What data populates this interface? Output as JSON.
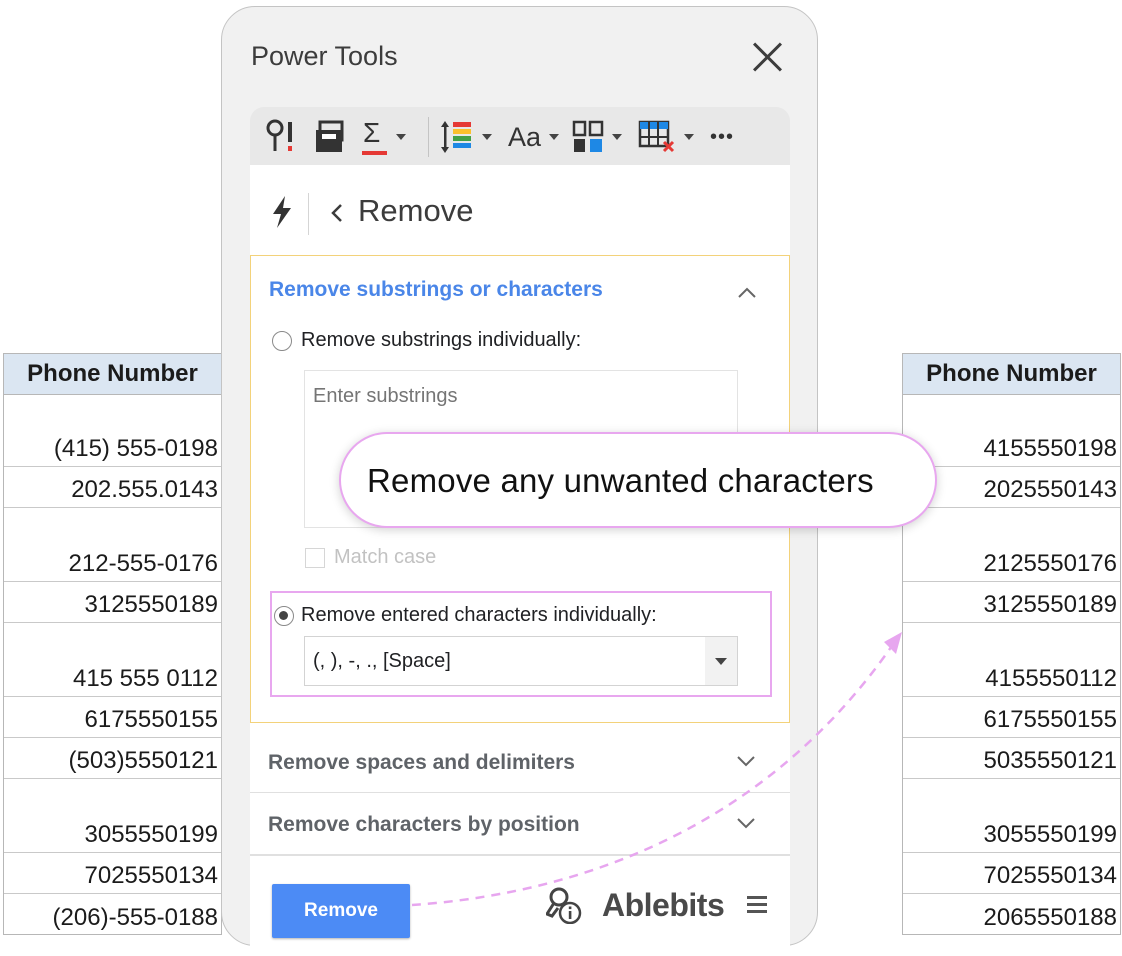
{
  "left_sheet": {
    "header": "Phone Number",
    "cells": [
      "(415) 555-0198",
      "202.555.0143",
      "212-555-0176",
      "3125550189",
      "415 555 0112",
      "6175550155",
      "(503)5550121",
      "3055550199",
      "7025550134",
      "(206)-555-0188"
    ]
  },
  "right_sheet": {
    "header": "Phone Number",
    "cells": [
      "4155550198",
      "2025550143",
      "2125550176",
      "3125550189",
      "4155550112",
      "6175550155",
      "5035550121",
      "3055550199",
      "7025550134",
      "2065550188"
    ]
  },
  "panel": {
    "title": "Power Tools",
    "toolbar": {
      "icons": [
        "key-info-icon",
        "save-icon",
        "sigma-icon",
        "sort-icon",
        "text-case-icon",
        "split-icon",
        "table-delete-icon",
        "more-icon"
      ],
      "text_case_label": "Aa",
      "sigma_label": "Σ",
      "more_label": "•••"
    },
    "nav": {
      "title": "Remove",
      "back_label": "‹"
    },
    "section_open": {
      "title": "Remove substrings or characters",
      "radio1_label": "Remove substrings individually:",
      "substrings_placeholder": "Enter substrings",
      "match_case_label": "Match case",
      "radio2_label": "Remove entered characters individually:",
      "characters_value": "(, ), -, ., [Space]"
    },
    "section_spaces": {
      "title": "Remove spaces and delimiters"
    },
    "section_position": {
      "title": "Remove characters by position"
    },
    "footer": {
      "remove_label": "Remove",
      "brand": "Ablebits"
    }
  },
  "callout": {
    "text": "Remove any unwanted characters"
  },
  "colors": {
    "accent_blue": "#4a86e8",
    "button_blue": "#4c8bf5",
    "highlight_pink": "#e8a7ef",
    "section_border": "#f3d27a",
    "sheet_header_bg": "#dbe6f2"
  }
}
